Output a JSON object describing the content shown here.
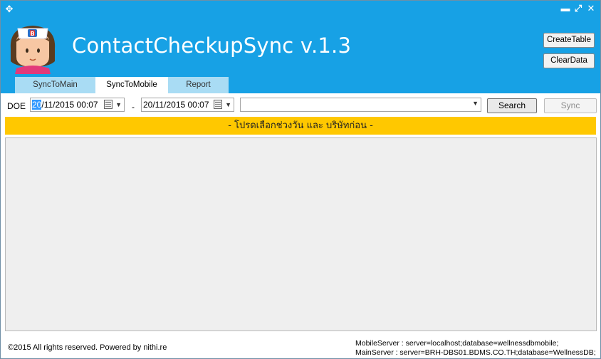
{
  "window": {
    "title": "ContactCheckupSync v.1.3",
    "controls": [
      "minimize",
      "maximize",
      "close"
    ]
  },
  "header": {
    "create_table_label": "CreateTable",
    "clear_data_label": "ClearData",
    "accent_color": "#17a1e5"
  },
  "tabs": [
    {
      "label": "SyncToMain",
      "active": false
    },
    {
      "label": "SyncToMobile",
      "active": true
    },
    {
      "label": "Report",
      "active": false
    }
  ],
  "filter": {
    "doe_label": "DOE",
    "date_from_selected": "20",
    "date_from_rest": "/11/2015 00:07",
    "separator": "-",
    "date_to": "20/11/2015 00:07",
    "company_value": "",
    "search_label": "Search",
    "sync_label": "Sync"
  },
  "banner": {
    "text": "- โปรดเลือกช่วงวัน และ บริษัทก่อน -",
    "color": "#ffc800"
  },
  "footer": {
    "copyright": "©2015 All rights reserved.  Powered by nithi.re",
    "mobile_server": "MobileServer : server=localhost;database=wellnessdbmobile;",
    "main_server": "MainServer : server=BRH-DBS01.BDMS.CO.TH;database=WellnessDB;"
  }
}
